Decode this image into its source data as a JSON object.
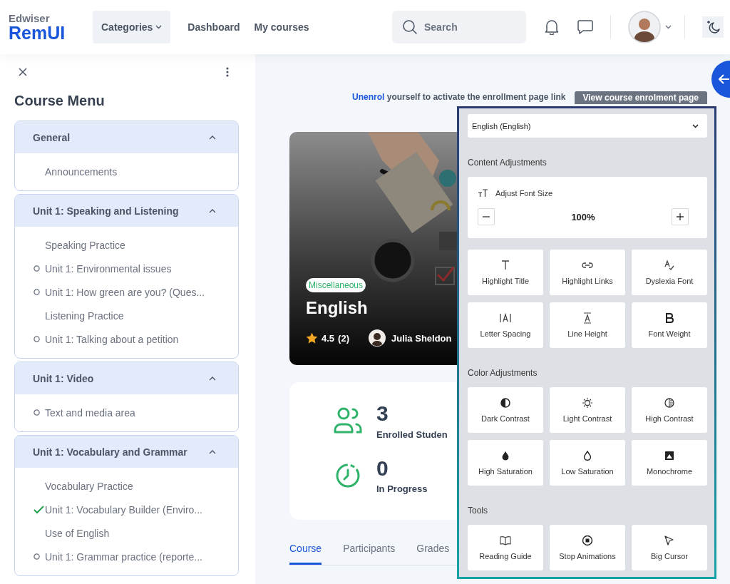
{
  "header": {
    "logo": {
      "top": "Edwiser",
      "bottom": "RemUI"
    },
    "nav": [
      {
        "label": "Categories",
        "kind": "dropdown"
      },
      {
        "label": "Dashboard",
        "kind": "link"
      },
      {
        "label": "My courses",
        "kind": "link"
      }
    ],
    "search": {
      "placeholder": "Search"
    }
  },
  "course_menu": {
    "title": "Course Menu",
    "sections": [
      {
        "title": "General",
        "expanded": true,
        "items": [
          {
            "label": "Announcements",
            "kind": "label"
          }
        ]
      },
      {
        "title": "Unit 1: Speaking and Listening",
        "expanded": true,
        "items": [
          {
            "label": "Speaking Practice",
            "kind": "label"
          },
          {
            "label": "Unit 1: Environmental issues",
            "kind": "activity",
            "completed": false
          },
          {
            "label": "Unit 1: How green are you? (Ques...",
            "kind": "activity",
            "completed": false
          },
          {
            "label": "Listening Practice",
            "kind": "label"
          },
          {
            "label": "Unit 1: Talking about a petition",
            "kind": "activity",
            "completed": false
          }
        ]
      },
      {
        "title": "Unit 1: Video",
        "expanded": true,
        "items": [
          {
            "label": "Text and media area",
            "kind": "activity",
            "completed": false
          }
        ]
      },
      {
        "title": "Unit 1: Vocabulary and Grammar",
        "expanded": true,
        "items": [
          {
            "label": "Vocabulary Practice",
            "kind": "label"
          },
          {
            "label": "Unit 1: Vocabulary Builder (Enviro...",
            "kind": "activity",
            "completed": true
          },
          {
            "label": "Use of English",
            "kind": "label"
          },
          {
            "label": "Unit 1: Grammar practice (reporte...",
            "kind": "activity",
            "completed": false
          }
        ]
      }
    ]
  },
  "notice": {
    "link": "Unenrol",
    "text": "yourself to activate the enrollment page link",
    "button": "View course enrolment page"
  },
  "course": {
    "badge": "Miscellaneous",
    "title": "English",
    "rating": "4.5",
    "reviews": "(2)",
    "teacher": "Julia Sheldon"
  },
  "stats": [
    {
      "kind": "people",
      "value": "3",
      "label": "Enrolled Studen"
    },
    {
      "kind": "clock",
      "value": "0",
      "label": "In Progress"
    }
  ],
  "tabs": [
    {
      "label": "Course",
      "selected": true
    },
    {
      "label": "Participants",
      "selected": false
    },
    {
      "label": "Grades",
      "selected": false
    }
  ],
  "accessibility": {
    "language": "English (English)",
    "sections": [
      {
        "title": "Content Adjustments",
        "font_size": {
          "label": "Adjust Font Size",
          "value": "100%"
        },
        "tools": [
          {
            "kind": "title",
            "label": "Highlight Title"
          },
          {
            "kind": "links",
            "label": "Highlight Links"
          },
          {
            "kind": "dyslexia",
            "label": "Dyslexia Font"
          },
          {
            "kind": "spacing",
            "label": "Letter Spacing"
          },
          {
            "kind": "lineheight",
            "label": "Line Height"
          },
          {
            "kind": "weight",
            "label": "Font Weight"
          }
        ]
      },
      {
        "title": "Color Adjustments",
        "tools": [
          {
            "kind": "dark",
            "label": "Dark Contrast"
          },
          {
            "kind": "light",
            "label": "Light Contrast"
          },
          {
            "kind": "high",
            "label": "High Contrast"
          },
          {
            "kind": "highsat",
            "label": "High Saturation"
          },
          {
            "kind": "lowsat",
            "label": "Low Saturation"
          },
          {
            "kind": "mono",
            "label": "Monochrome"
          }
        ]
      },
      {
        "title": "Tools",
        "tools": [
          {
            "kind": "guide",
            "label": "Reading Guide"
          },
          {
            "kind": "stop",
            "label": "Stop Animations"
          },
          {
            "kind": "cursor",
            "label": "Big Cursor"
          }
        ]
      }
    ]
  }
}
